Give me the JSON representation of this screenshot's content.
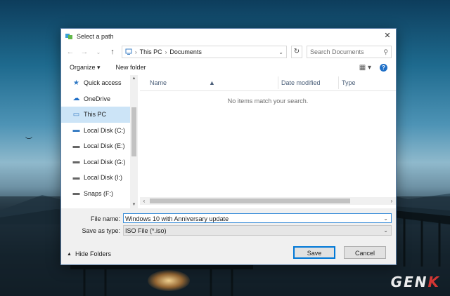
{
  "dialog": {
    "title": "Select a path",
    "close": "✕"
  },
  "nav": {
    "back": "←",
    "forward": "→",
    "recent": "⌄",
    "up": "↑",
    "path": [
      "This PC",
      "Documents"
    ],
    "refresh": "↻",
    "search_placeholder": "Search Documents"
  },
  "toolbar": {
    "organize": "Organize ▾",
    "new_folder": "New folder",
    "view": "▦ ▾",
    "help": "?"
  },
  "sidebar": {
    "items": [
      {
        "label": "Quick access",
        "icon": "star-icon"
      },
      {
        "label": "OneDrive",
        "icon": "cloud-icon"
      },
      {
        "label": "This PC",
        "icon": "computer-icon",
        "selected": true
      },
      {
        "label": "Local Disk (C:)",
        "icon": "windows-drive-icon"
      },
      {
        "label": "Local Disk (E:)",
        "icon": "drive-icon"
      },
      {
        "label": "Local Disk (G:)",
        "icon": "drive-icon"
      },
      {
        "label": "Local Disk (I:)",
        "icon": "drive-icon"
      },
      {
        "label": "Snaps (F:)",
        "icon": "drive-icon"
      }
    ]
  },
  "columns": {
    "name": "Name",
    "date_modified": "Date modified",
    "type": "Type"
  },
  "empty_message": "No items match your search.",
  "form": {
    "file_name_label": "File name:",
    "file_name_value": "Windows 10 with Anniversary update",
    "save_as_type_label": "Save as type:",
    "save_as_type_value": "ISO File (*.iso)"
  },
  "footer": {
    "hide_folders": "Hide Folders",
    "save": "Save",
    "cancel": "Cancel"
  },
  "watermark": {
    "text_a": "GEN",
    "text_b": "K"
  },
  "colors": {
    "accent": "#0078d7",
    "selection": "#cce4f7"
  }
}
